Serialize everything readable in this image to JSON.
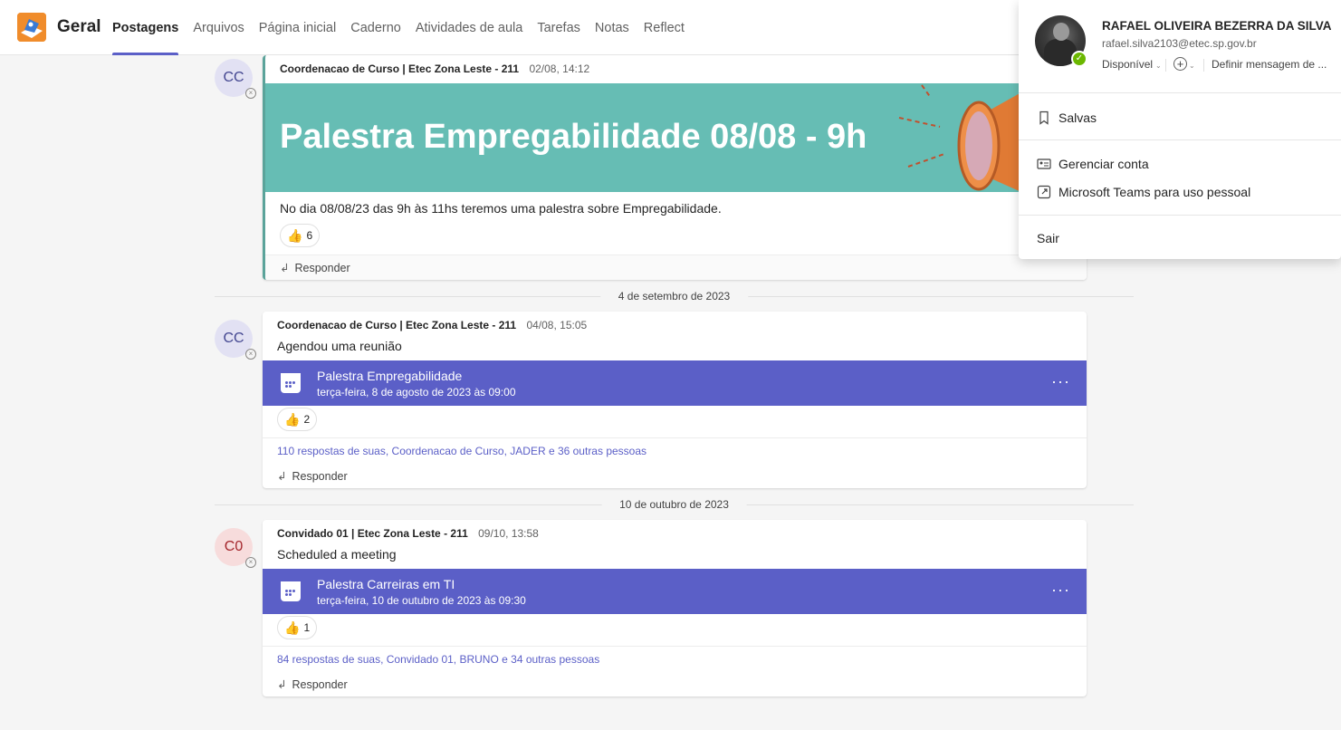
{
  "header": {
    "channel_name": "Geral",
    "tabs": [
      {
        "label": "Postagens",
        "active": true
      },
      {
        "label": "Arquivos"
      },
      {
        "label": "Página inicial"
      },
      {
        "label": "Caderno"
      },
      {
        "label": "Atividades de aula"
      },
      {
        "label": "Tarefas"
      },
      {
        "label": "Notas"
      },
      {
        "label": "Reflect"
      }
    ]
  },
  "posts": [
    {
      "avatar": "CC",
      "author": "Coordenacao de Curso | Etec Zona Leste - 211",
      "time": "02/08, 14:12",
      "banner_title": "Palestra Empregabilidade 08/08 - 9h",
      "text": "No dia 08/08/23 das 9h às 11hs teremos uma palestra sobre Empregabilidade.",
      "reaction_count": "6",
      "reply_label": "Responder"
    },
    {
      "avatar": "CC",
      "author": "Coordenacao de Curso | Etec Zona Leste - 211",
      "time": "04/08, 15:05",
      "text": "Agendou uma reunião",
      "meeting_title": "Palestra Empregabilidade",
      "meeting_date": "terça-feira, 8 de agosto de 2023 às 09:00",
      "reaction_count": "2",
      "replies": "110 respostas de suas, Coordenacao de Curso, JADER e 36 outras pessoas",
      "reply_label": "Responder"
    },
    {
      "avatar": "C0",
      "author": "Convidado 01 | Etec Zona Leste - 211",
      "time": "09/10, 13:58",
      "text": "Scheduled a meeting",
      "meeting_title": "Palestra Carreiras em TI",
      "meeting_date": "terça-feira, 10 de outubro de 2023 às 09:30",
      "reaction_count": "1",
      "replies": "84 respostas de suas, Convidado 01, BRUNO e 34 outras pessoas",
      "reply_label": "Responder"
    }
  ],
  "date_separators": [
    "4 de setembro de 2023",
    "10 de outubro de 2023"
  ],
  "profile": {
    "name": "RAFAEL OLIVEIRA BEZERRA DA SILVA",
    "email": "rafael.silva2103@etec.sp.gov.br",
    "status": "Disponível",
    "status_message": "Definir mensagem de ...",
    "menu": {
      "saved": "Salvas",
      "manage_account": "Gerenciar conta",
      "personal_teams": "Microsoft Teams para uso pessoal",
      "sign_out": "Sair"
    }
  },
  "colors": {
    "accent": "#5b5fc7",
    "banner": "#66bdb4",
    "team_logo": "#f08c2b",
    "status_available": "#6bb700"
  },
  "icons": [
    "team-logo-icon",
    "thumbs-up-icon",
    "reply-arrow-icon",
    "calendar-icon",
    "more-options-icon",
    "bookmark-icon",
    "contact-card-icon",
    "external-link-icon",
    "add-circle-icon",
    "available-check-icon"
  ]
}
